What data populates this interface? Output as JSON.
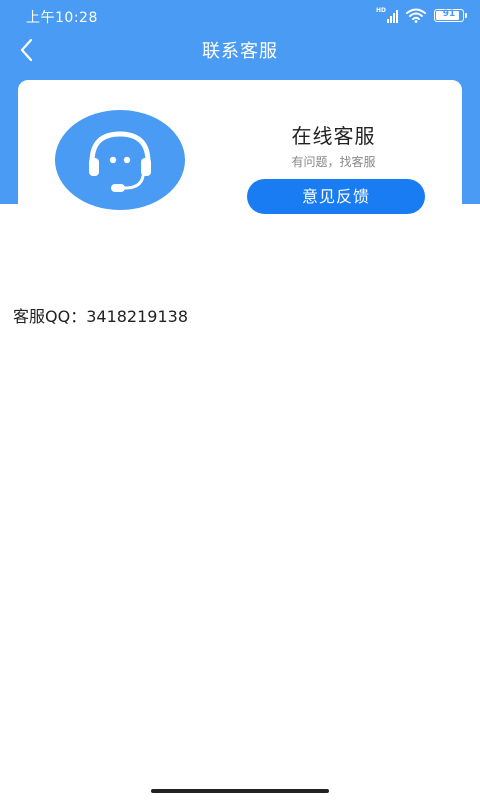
{
  "status_bar": {
    "time": "上午10:28",
    "signal_badge": "HD",
    "battery_level": "91",
    "battery_fraction": 0.91
  },
  "nav": {
    "back_icon": "chevron-left-icon",
    "title": "联系客服"
  },
  "card": {
    "avatar_icon": "headset-icon",
    "title": "在线客服",
    "subtitle": "有问题，找客服",
    "feedback_label": "意见反馈"
  },
  "contact": {
    "qq_label": "客服QQ：",
    "qq_number": "3418219138"
  },
  "colors": {
    "header_blue": "#4a9bf3",
    "button_blue": "#1a7cf2"
  }
}
